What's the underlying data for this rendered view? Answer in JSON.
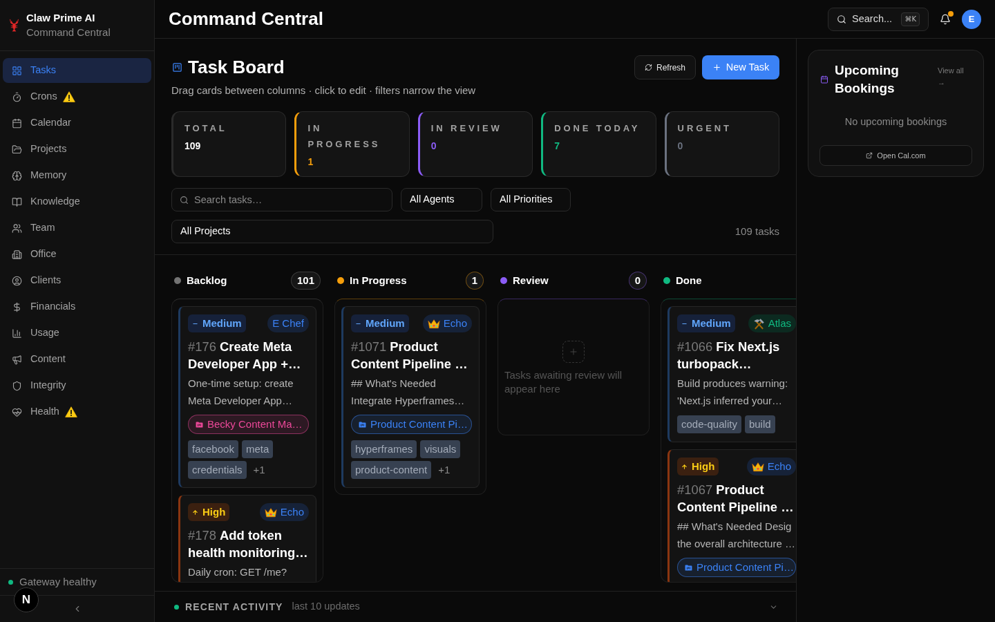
{
  "sidebar": {
    "brand": {
      "name": "Claw Prime AI",
      "subtitle": "Command Central"
    },
    "items": [
      {
        "label": "Tasks",
        "selected": true,
        "warning": false
      },
      {
        "label": "Crons",
        "selected": false,
        "warning": true
      },
      {
        "label": "Calendar",
        "selected": false,
        "warning": false
      },
      {
        "label": "Projects",
        "selected": false,
        "warning": false
      },
      {
        "label": "Memory",
        "selected": false,
        "warning": false
      },
      {
        "label": "Knowledge",
        "selected": false,
        "warning": false
      },
      {
        "label": "Team",
        "selected": false,
        "warning": false
      },
      {
        "label": "Office",
        "selected": false,
        "warning": false
      },
      {
        "label": "Clients",
        "selected": false,
        "warning": false
      },
      {
        "label": "Financials",
        "selected": false,
        "warning": false
      },
      {
        "label": "Usage",
        "selected": false,
        "warning": false
      },
      {
        "label": "Content",
        "selected": false,
        "warning": false
      },
      {
        "label": "Integrity",
        "selected": false,
        "warning": false
      },
      {
        "label": "Health",
        "selected": false,
        "warning": true
      }
    ],
    "status": "Gateway healthy",
    "dev_badge": "N"
  },
  "topbar": {
    "title": "Command Central",
    "search": {
      "label": "Search...",
      "shortcut": "⌘K"
    },
    "notifications": {
      "unread": true
    },
    "avatar": "E"
  },
  "board_header": {
    "title": "Task Board",
    "subtitle": "Drag cards between columns · click to edit · filters narrow the view",
    "buttons": [
      {
        "label": "Refresh",
        "kind": "secondary"
      },
      {
        "label": "New Task",
        "kind": "primary"
      }
    ]
  },
  "stats": [
    {
      "label": "TOTAL",
      "value": "109"
    },
    {
      "label": "IN PROGRESS",
      "value": "1",
      "color": "#f59e0b"
    },
    {
      "label": "IN REVIEW",
      "value": "0",
      "color": "#8b5cf6"
    },
    {
      "label": "DONE TODAY",
      "value": "7",
      "color": "#10b981"
    },
    {
      "label": "URGENT",
      "value": "0",
      "color": "#6b7280"
    }
  ],
  "filters": {
    "search": {
      "placeholder": "Search tasks…"
    },
    "agent": "All Agents",
    "priority": "All Priorities",
    "project": "All Projects",
    "task_count": "109 tasks"
  },
  "columns": [
    {
      "name": "Backlog",
      "color": "#737373",
      "count": "101",
      "cards": [
        {
          "priority": {
            "label": "Medium",
            "kind": "medium"
          },
          "agent": {
            "name": "E Chef",
            "kind": "plain"
          },
          "title": "#176 **Create Meta Developer App +…**",
          "description": "One-time setup: create Meta Developer App…",
          "project": {
            "name": "Becky Content Ma…",
            "color": "#ec4899"
          },
          "tags": [
            "facebook",
            "meta",
            "credentials"
          ],
          "more": "+1"
        },
        {
          "priority": {
            "label": "High",
            "kind": "high"
          },
          "agent": {
            "name": "Echo",
            "kind": "crown"
          },
          "title": "#178 **Add token health monitoring…**",
          "description": "Daily cron: GET /me?"
        }
      ]
    },
    {
      "name": "In Progress",
      "color": "#f59e0b",
      "count": "1",
      "cards": [
        {
          "priority": {
            "label": "Medium",
            "kind": "medium"
          },
          "agent": {
            "name": "Echo",
            "kind": "crown"
          },
          "title": "#1071 **Product Content Pipeline …**",
          "description": "## What's Needed Integrate Hyperframes…",
          "project": {
            "name": "Product Content Pi…",
            "color": "#3b82f6"
          },
          "tags": [
            "hyperframes",
            "visuals",
            "product-content"
          ],
          "more": "+1"
        }
      ]
    },
    {
      "name": "Review",
      "color": "#8b5cf6",
      "count": "0",
      "empty_text": "Tasks awaiting review will appear here"
    },
    {
      "name": "Done",
      "color": "#10b981",
      "cards": [
        {
          "priority": {
            "label": "Medium",
            "kind": "medium"
          },
          "agent": {
            "name": "Atlas",
            "kind": "tools"
          },
          "title": "#1066 **Fix Next.js turbopack…**",
          "description": "Build produces warning: 'Next.js inferred your…",
          "tags": [
            "code-quality",
            "build"
          ]
        },
        {
          "priority": {
            "label": "High",
            "kind": "high"
          },
          "agent": {
            "name": "Echo",
            "kind": "crown"
          },
          "title": "#1067 **Product Content Pipeline …**",
          "description": "## What's Needed Desig the overall architecture …",
          "project": {
            "name": "Product Content Pi…",
            "color": "#3b82f6"
          }
        }
      ]
    }
  ],
  "recent_activity": {
    "title": "RECENT ACTIVITY",
    "subtitle": "last 10 updates",
    "expanded": false
  },
  "bookings": {
    "title": "Upcoming Bookings",
    "view_all": "View all →",
    "empty": "No upcoming bookings",
    "button": "Open Cal.com"
  }
}
